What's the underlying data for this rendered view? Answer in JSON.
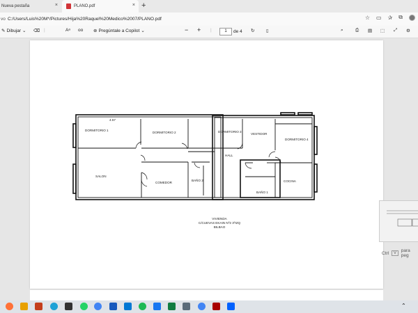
{
  "tabs": [
    {
      "label": "Nueva pestaña",
      "close": "×"
    },
    {
      "label": "PLANO.pdf",
      "close": "×"
    }
  ],
  "new_tab": "+",
  "address": {
    "lead": "vo",
    "url": "C:/Users/Luis%20M*/Pictures/Hija%20Raquel%20Medico%2007/PLANO.pdf"
  },
  "toolbar": {
    "draw": "Dibujar",
    "copilot": "Pregúntale a Copilot",
    "zoom_out": "−",
    "zoom_in": "+",
    "page_current": "1",
    "page_total": "de 4"
  },
  "plan": {
    "dimension": "4.57",
    "rooms": {
      "dormitorio1": "DORMITORIO 1",
      "dormitorio2": "DORMITORIO 2",
      "dormitorio3": "DORMITORIO 3",
      "vestidor": "VESTIDOR",
      "dormitorio4": "DORMITORIO 4",
      "hall": "HALL",
      "salon": "SALON",
      "comedor": "COMEDOR",
      "bano2": "BAÑO 2",
      "bano1": "BAÑO 1",
      "cocina": "COCINA"
    },
    "caption": [
      "VIVIENDA",
      "C/CUEVAS EKAIN Nº2 3ºIZQ",
      "BILBAO"
    ]
  },
  "hint": {
    "key": "Ctrl",
    "key2": "V",
    "text": "para peg"
  },
  "colors": {
    "page": "#ffffff",
    "viewer": "#e6e6e6",
    "wall": "#111111",
    "taskbar": "#dfe3e8"
  }
}
